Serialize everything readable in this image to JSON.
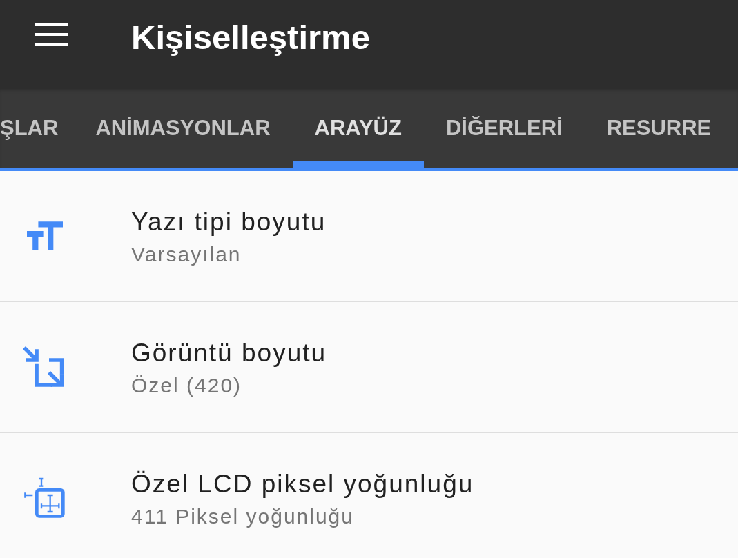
{
  "app_bar": {
    "title": "Kişiselleştirme"
  },
  "tabs": [
    {
      "label": "ŞLAR",
      "selected": false
    },
    {
      "label": "ANİMASYONLAR",
      "selected": false
    },
    {
      "label": "ARAYÜZ",
      "selected": true
    },
    {
      "label": "DİĞERLERİ",
      "selected": false
    },
    {
      "label": "RESURRE",
      "selected": false
    }
  ],
  "settings": [
    {
      "title": "Yazı tipi boyutu",
      "summary": "Varsayılan"
    },
    {
      "title": "Görüntü boyutu",
      "summary": "Özel (420)"
    },
    {
      "title": "Özel LCD piksel yoğunluğu",
      "summary": "411 Piksel yoğunluğu"
    }
  ]
}
